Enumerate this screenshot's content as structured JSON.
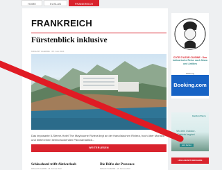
{
  "nav": {
    "tabs": [
      {
        "label": "HOME"
      },
      {
        "label": "EUSLAN"
      },
      {
        "label": "FRANKREICH"
      }
    ]
  },
  "section": {
    "title": "FRANKREICH"
  },
  "article": {
    "title": "Fürstenblick inklusive",
    "meta": "KRIGAST GUERRE · 05. Juni 2024",
    "excerpt": "Das imposante 5-Sterne-Hotel The Maybourne Riviera liegt an der französischen Riviera, hoch über Monaco und bietet einen beeindruckenden Panoramablick...",
    "read_more": "WEITERLESEN"
  },
  "related": [
    {
      "title": "Schlosshotel trifft Aktivurlaub",
      "meta": "KRIGAST GUERRE · 28. Februar 2022"
    },
    {
      "title": "Die Düfte der Provence",
      "meta": "KRIGAST GUERRE · 15. Februar 2022"
    }
  ],
  "sidebar": {
    "brand_title": "COTE D'AZUR CUISINE · Das",
    "brand_sub": "kulinarische Reise nach Nizza und Antibes",
    "ad_label": "Werbung",
    "booking": "Booking.com",
    "ad2_brand": "Gardon Parco",
    "ad2_text": "Wo dein Outdoor-Erlebnis beginnt",
    "ad2_button": "Jetzt buchen",
    "red_button": "URLAUB MIT DER EHRE"
  },
  "colors": {
    "accent": "#d9232d",
    "booking": "#1763c5",
    "teal": "#2b8a8a"
  }
}
